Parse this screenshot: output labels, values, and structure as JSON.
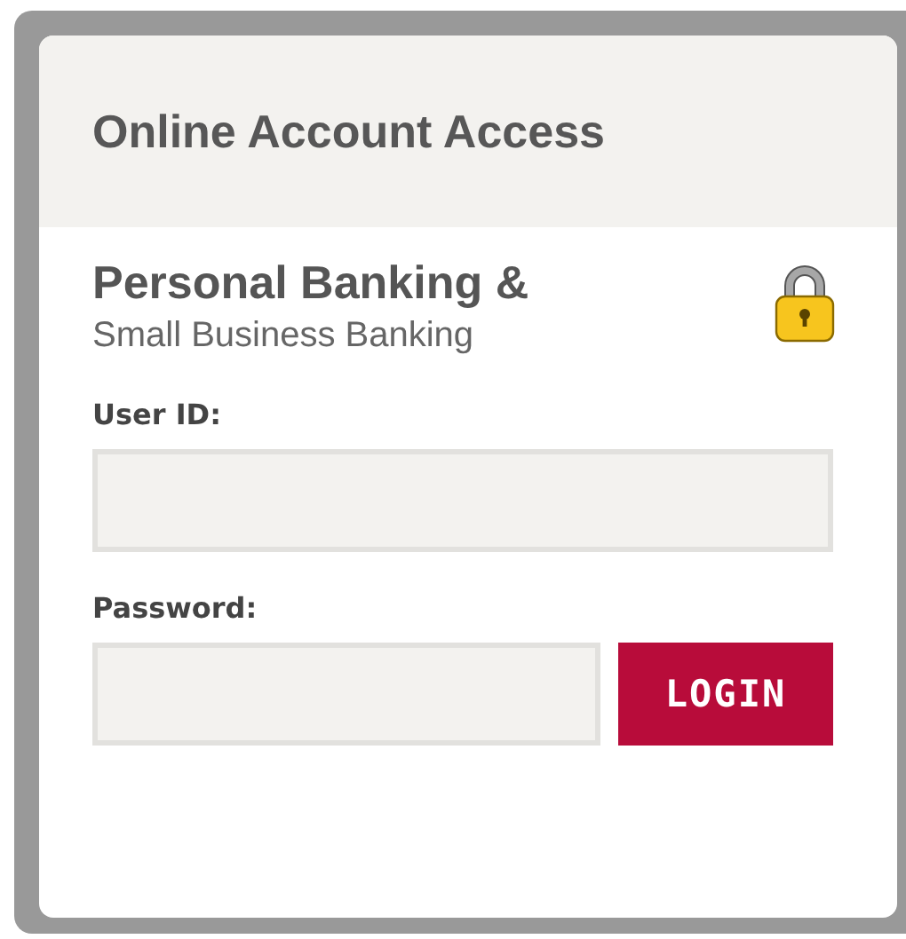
{
  "header": {
    "title": "Online Account Access"
  },
  "section": {
    "title": "Personal Banking &",
    "subtitle": "Small Business Banking"
  },
  "fields": [
    {
      "label": "User ID:",
      "kind": "text"
    },
    {
      "label": "Password:",
      "kind": "password"
    }
  ],
  "login_button": {
    "label": "LOGIN"
  }
}
